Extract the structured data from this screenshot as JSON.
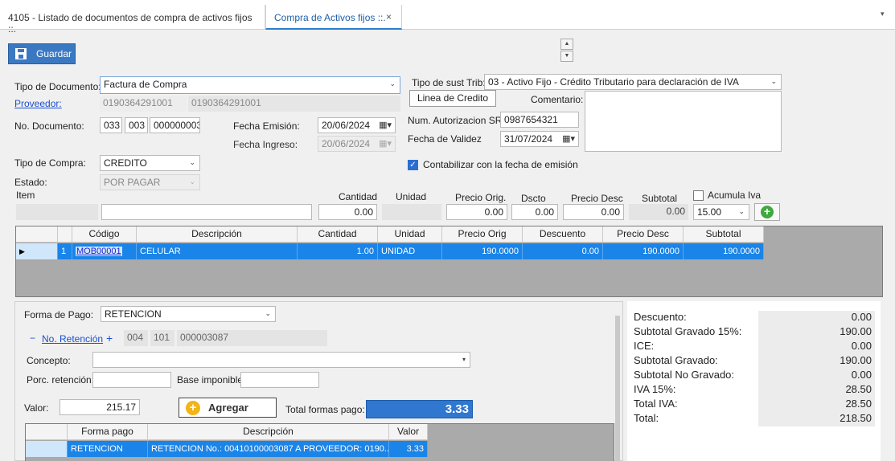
{
  "tabs": [
    {
      "label": "4105 - Listado de documentos de compra de activos fijos ::."
    },
    {
      "label": "Compra de Activos fijos ::.",
      "close": "×"
    }
  ],
  "toolbar": {
    "save_label": "Guardar",
    "dropdown_glyph": "▾",
    "spin_up": "▲",
    "spin_down": "▼"
  },
  "form": {
    "tipo_documento_label": "Tipo de Documento:",
    "tipo_documento_value": "Factura de Compra",
    "proveedor_label": "Proveedor:",
    "proveedor_ruc": "0190364291001",
    "proveedor_name": "0190364291001",
    "no_documento_label": "No. Documento:",
    "doc_serie1": "033",
    "doc_serie2": "003",
    "doc_numero": "000000003",
    "fecha_emision_label": "Fecha Emisión:",
    "fecha_emision": "20/06/2024",
    "fecha_ingreso_label": "Fecha Ingreso:",
    "fecha_ingreso": "20/06/2024",
    "tipo_compra_label": "Tipo de Compra:",
    "tipo_compra_value": "CREDITO",
    "estado_label": "Estado:",
    "estado_value": "POR PAGAR",
    "tipo_sust_label": "Tipo de sust Trib:",
    "tipo_sust_value": "03 - Activo Fijo - Crédito Tributario para declaración de IVA",
    "linea_credito_label": "Linea de Credito",
    "comentario_label": "Comentario:",
    "num_autorizacion_label": "Num. Autorizacion SRI",
    "num_autorizacion": "0987654321",
    "fecha_validez_label": "Fecha de Validez",
    "fecha_validez": "31/07/2024",
    "contabilizar_label": "Contabilizar con la fecha de emisión"
  },
  "item_entry": {
    "item_label": "Item",
    "cantidad_label": "Cantidad",
    "unidad_label": "Unidad",
    "precio_orig_label": "Precio Orig.",
    "dscto_label": "Dscto",
    "precio_desc_label": "Precio Desc",
    "subtotal_label": "Subtotal",
    "acumula_iva_label": "Acumula Iva",
    "cantidad": "0.00",
    "precio_orig": "0.00",
    "dscto": "0.00",
    "precio_desc": "0.00",
    "subtotal": "0.00",
    "iva": "15.00",
    "add_glyph": "+"
  },
  "items_grid": {
    "columns": [
      "Código",
      "Descripción",
      "Cantidad",
      "Unidad",
      "Precio Orig",
      "Descuento",
      "Precio Desc",
      "Subtotal"
    ],
    "rows": [
      {
        "num": "1",
        "codigo": "MOB00001",
        "descripcion": "CELULAR",
        "cantidad": "1.00",
        "unidad": "UNIDAD",
        "precio_orig": "190.0000",
        "descuento": "0.00",
        "precio_desc": "190.0000",
        "subtotal": "190.0000"
      }
    ]
  },
  "payment": {
    "forma_pago_label": "Forma de Pago:",
    "forma_pago_value": "RETENCION",
    "minus": "−",
    "plus": "+",
    "no_retencion_label": "No. Retención",
    "ret_serie1": "004",
    "ret_serie2": "101",
    "ret_numero": "000003087",
    "concepto_label": "Concepto:",
    "porc_retencion_label": "Porc. retención:",
    "base_imponible_label": "Base imponible:",
    "valor_label": "Valor:",
    "valor": "215.17",
    "agregar_label": "Agregar",
    "agregar_glyph": "+",
    "total_formas_label": "Total formas pago:",
    "total_formas": "3.33"
  },
  "payments_grid": {
    "columns": [
      "Forma pago",
      "Descripción",
      "Valor"
    ],
    "rows": [
      {
        "forma": "RETENCION",
        "descripcion": "RETENCION No.: 00410100003087 A PROVEEDOR: 0190...",
        "valor": "3.33"
      }
    ]
  },
  "summary": [
    {
      "label": "Descuento:",
      "value": "0.00"
    },
    {
      "label": "Subtotal Gravado 15%:",
      "value": "190.00"
    },
    {
      "label": "ICE:",
      "value": "0.00"
    },
    {
      "label": "Subtotal Gravado:",
      "value": "190.00"
    },
    {
      "label": "Subtotal No Gravado:",
      "value": "0.00"
    },
    {
      "label": "IVA 15%:",
      "value": "28.50"
    },
    {
      "label": "Total IVA:",
      "value": "28.50"
    },
    {
      "label": "Total:",
      "value": "218.50"
    }
  ]
}
